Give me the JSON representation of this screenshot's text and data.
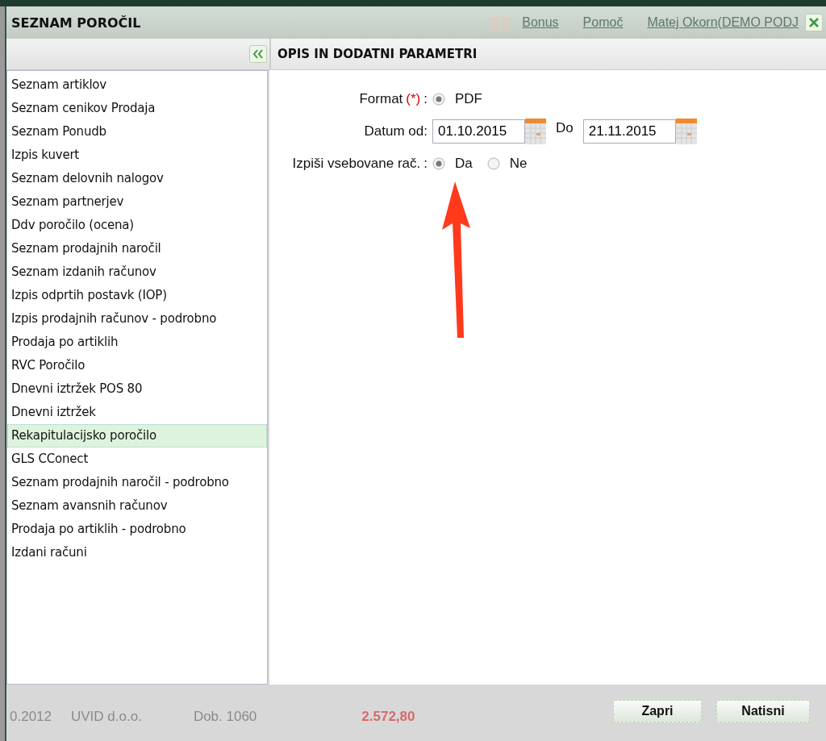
{
  "background": {
    "header_links": [
      "Bonus",
      "Pomoč",
      "Matej Okorn(DEMO PODJ"
    ],
    "row": [
      "0.2012",
      "UVID d.o.o.",
      "Dob. 1060",
      "2.572,80"
    ]
  },
  "dialog": {
    "title": "SEZNAM POROČIL",
    "reports": [
      {
        "label": "Seznam artiklov",
        "selected": false
      },
      {
        "label": "Seznam cenikov Prodaja",
        "selected": false
      },
      {
        "label": "Seznam Ponudb",
        "selected": false
      },
      {
        "label": "Izpis kuvert",
        "selected": false
      },
      {
        "label": "Seznam delovnih nalogov",
        "selected": false
      },
      {
        "label": "Seznam partnerjev",
        "selected": false
      },
      {
        "label": "Ddv poročilo (ocena)",
        "selected": false
      },
      {
        "label": "Seznam prodajnih naročil",
        "selected": false
      },
      {
        "label": "Seznam izdanih računov",
        "selected": false
      },
      {
        "label": "Izpis odprtih postavk (IOP)",
        "selected": false
      },
      {
        "label": "Izpis prodajnih računov - podrobno",
        "selected": false
      },
      {
        "label": "Prodaja po artiklih",
        "selected": false
      },
      {
        "label": "RVC Poročilo",
        "selected": false
      },
      {
        "label": "Dnevni iztržek POS 80",
        "selected": false
      },
      {
        "label": "Dnevni iztržek",
        "selected": false
      },
      {
        "label": "Rekapitulacijsko poročilo",
        "selected": true
      },
      {
        "label": "GLS CConect",
        "selected": false
      },
      {
        "label": "Seznam prodajnih naročil - podrobno",
        "selected": false
      },
      {
        "label": "Seznam avansnih računov",
        "selected": false
      },
      {
        "label": "Prodaja po artiklih - podrobno",
        "selected": false
      },
      {
        "label": "Izdani računi",
        "selected": false
      }
    ],
    "params_title": "OPIS IN DODATNI PARAMETRI",
    "fields": [
      {
        "kind": "radio",
        "label": "Format",
        "required_mark": "(*)",
        "colon": ":",
        "options": [
          {
            "label": "PDF",
            "selected": true
          }
        ]
      },
      {
        "kind": "daterange",
        "label": "Datum od:",
        "from": "01.10.2015",
        "to_label": "Do",
        "to": "21.11.2015"
      },
      {
        "kind": "radio",
        "label": "Izpiši vsebovane rač.",
        "colon": ":",
        "options": [
          {
            "label": "Da",
            "selected": true
          },
          {
            "label": "Ne",
            "selected": false
          }
        ]
      }
    ],
    "buttons": [
      "Zapri",
      "Natisni"
    ]
  }
}
